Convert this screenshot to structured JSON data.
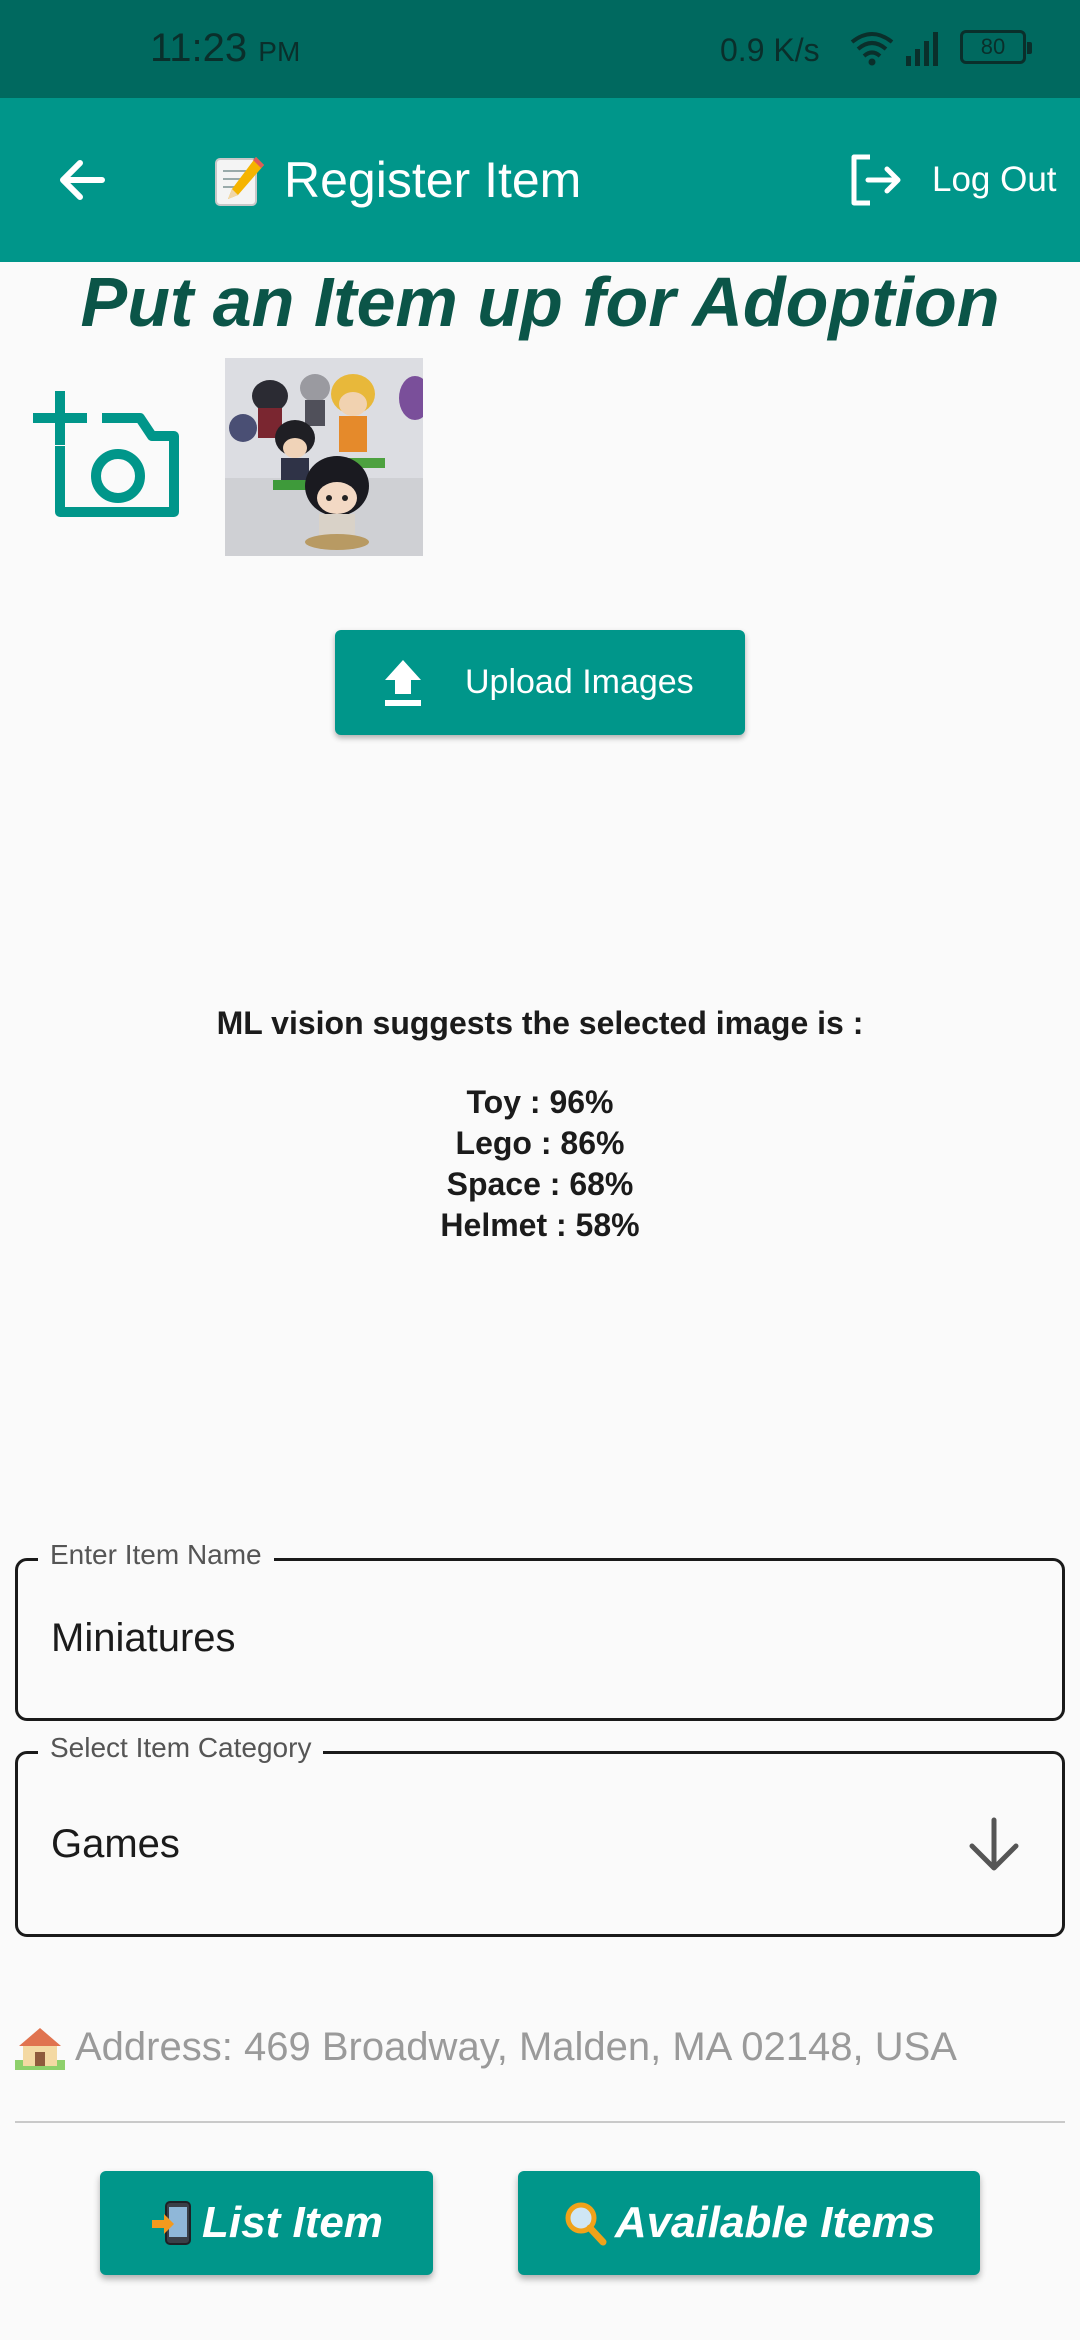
{
  "status_bar": {
    "time": "11:23",
    "ampm": "PM",
    "network_speed": "0.9 K/s",
    "battery": "80"
  },
  "app_bar": {
    "title": "Register Item",
    "logout_label": "Log Out"
  },
  "main": {
    "heading": "Put an Item up for Adoption",
    "upload_label": "Upload Images"
  },
  "ml": {
    "heading": "ML vision suggests the selected image is :",
    "suggestions": [
      "Toy : 96%",
      "Lego : 86%",
      "Space : 68%",
      "Helmet : 58%"
    ]
  },
  "form": {
    "name_label": "Enter Item Name",
    "name_value": "Miniatures",
    "category_label": "Select Item Category",
    "category_value": "Games",
    "address": "Address: 469 Broadway, Malden, MA 02148, USA"
  },
  "buttons": {
    "list_item": "List Item",
    "available_items": "Available Items"
  },
  "colors": {
    "primary": "#00968a",
    "status_bar": "#00695f",
    "heading": "#0b5548"
  }
}
